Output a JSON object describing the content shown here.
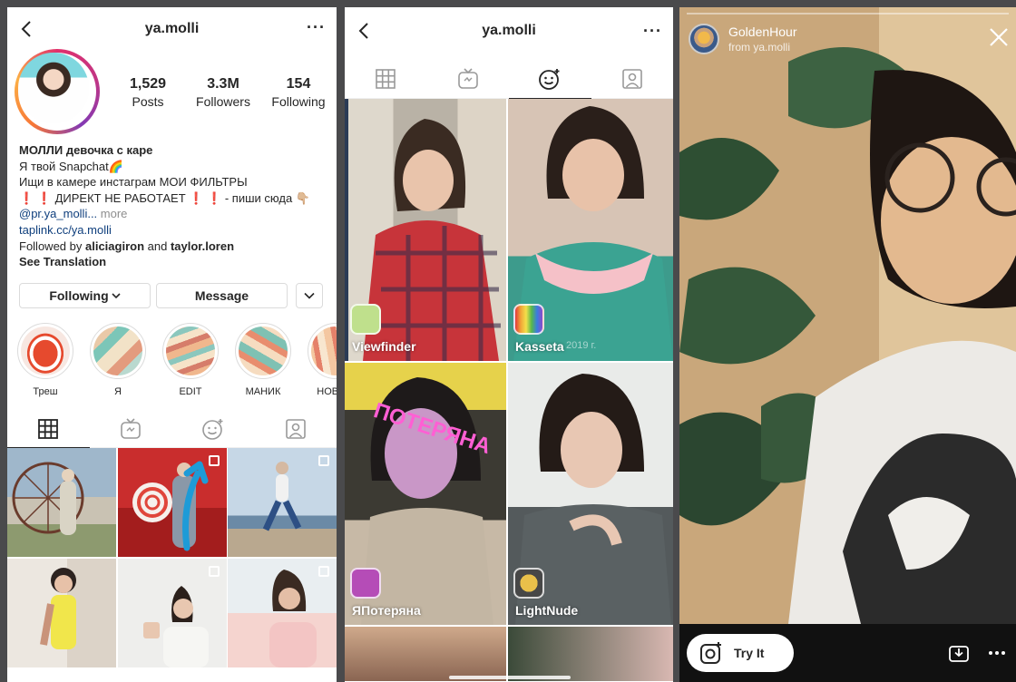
{
  "profile": {
    "username": "ya.molli",
    "stats": [
      {
        "value": "1,529",
        "label": "Posts"
      },
      {
        "value": "3.3M",
        "label": "Followers"
      },
      {
        "value": "154",
        "label": "Following"
      }
    ],
    "bio": {
      "name": "МОЛЛИ девочка с каре",
      "line1": "Я твой Snapchat🌈",
      "line2": "Ищи в камере инстаграм МОИ ФИЛЬТРЫ",
      "line3": "❗ ❗ ДИРЕКТ НЕ РАБОТАЕТ ❗ ❗ - пиши сюда 👇🏼",
      "mention": "@pr.ya_molli...",
      "more": " more",
      "link": "taplink.cc/ya.molli",
      "followed_prefix": "Followed by ",
      "followed_user1": "aliciagiron",
      "followed_and": " and ",
      "followed_user2": "taylor.loren",
      "see_translation": "See Translation"
    },
    "buttons": {
      "following": "Following",
      "message": "Message"
    },
    "highlights": [
      {
        "label": "Треш"
      },
      {
        "label": "Я"
      },
      {
        "label": "EDIT"
      },
      {
        "label": "МАНИК"
      },
      {
        "label": "НОВЫЙ"
      }
    ]
  },
  "effects_page": {
    "username": "ya.molli",
    "effects": [
      {
        "name": "Viewfinder",
        "year": ""
      },
      {
        "name": "Kasseta",
        "year": "2019 г."
      },
      {
        "name": "ЯПотеряна",
        "year": ""
      },
      {
        "name": "LightNude",
        "year": ""
      }
    ],
    "overlay_text": "ПОТЕРЯНА"
  },
  "preview": {
    "effect_name": "GoldenHour",
    "from": "from ya.molli",
    "try_it": "Try It"
  },
  "colors": {
    "accent_blue": "#0f3f7d",
    "arrow": "#1e9bd7"
  }
}
